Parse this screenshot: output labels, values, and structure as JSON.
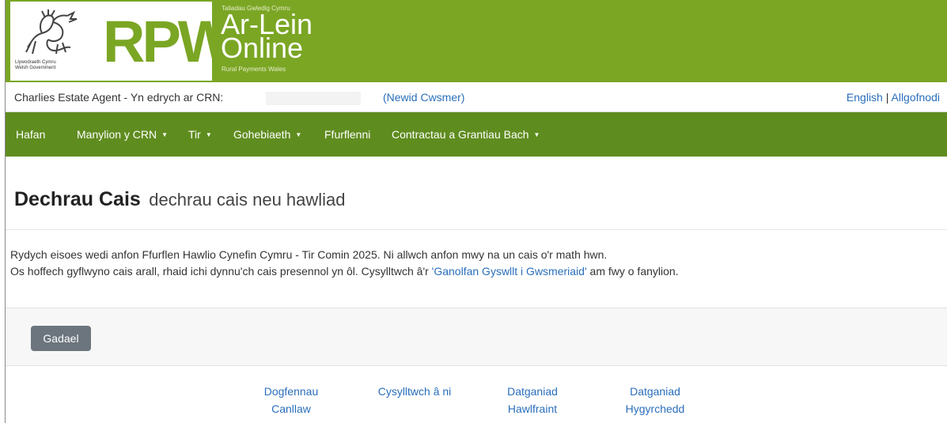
{
  "header": {
    "gov_name_cy": "Llywodraeth Cymru",
    "gov_name_en": "Welsh Government",
    "rpw_logo": "RPW",
    "online_small": "Taliadau Gwledig Cymru",
    "online_line1": "Ar-Lein",
    "online_line2": "Online",
    "online_bottom": "Rural Payments Wales"
  },
  "customer_bar": {
    "viewing_text": "Charlies Estate Agent - Yn edrych ar CRN:",
    "crn_value": "",
    "change_customer": "(Newid Cwsmer)",
    "lang_english": "English",
    "separator": "|",
    "logout": "Allgofnodi"
  },
  "nav": {
    "items": [
      {
        "label": "Hafan",
        "dropdown": false
      },
      {
        "label": "Manylion y CRN",
        "dropdown": true
      },
      {
        "label": "Tir",
        "dropdown": true
      },
      {
        "label": "Gohebiaeth",
        "dropdown": true
      },
      {
        "label": "Ffurflenni",
        "dropdown": false
      },
      {
        "label": "Contractau a Grantiau Bach",
        "dropdown": true
      }
    ],
    "caret": "▼"
  },
  "page": {
    "title": "Dechrau Cais",
    "subtitle": "dechrau cais neu hawliad",
    "message_line1": "Rydych eisoes wedi anfon Ffurflen Hawlio Cynefin Cymru - Tir Comin 2025. Ni allwch anfon mwy na un cais o'r math hwn.",
    "message_line2_pre": "Os hoffech gyflwyno cais arall, rhaid ichi dynnu'ch cais presennol yn ôl. Cysylltwch â'r ",
    "message_link": "'Ganolfan Gyswllt i Gwsmeriaid'",
    "message_line2_post": " am fwy o fanylion.",
    "exit_button": "Gadael"
  },
  "footer": {
    "links": [
      {
        "line1": "Dogfennau",
        "line2": "Canllaw"
      },
      {
        "line1": "Cysylltwch â ni",
        "line2": ""
      },
      {
        "line1": "Datganiad",
        "line2": "Hawlfraint"
      },
      {
        "line1": "Datganiad",
        "line2": "Hygyrchedd"
      }
    ]
  },
  "colors": {
    "brand_green": "#7aa624",
    "nav_green": "#5f8c1f",
    "link_blue": "#2a6ebb",
    "button_grey": "#6c757d"
  }
}
